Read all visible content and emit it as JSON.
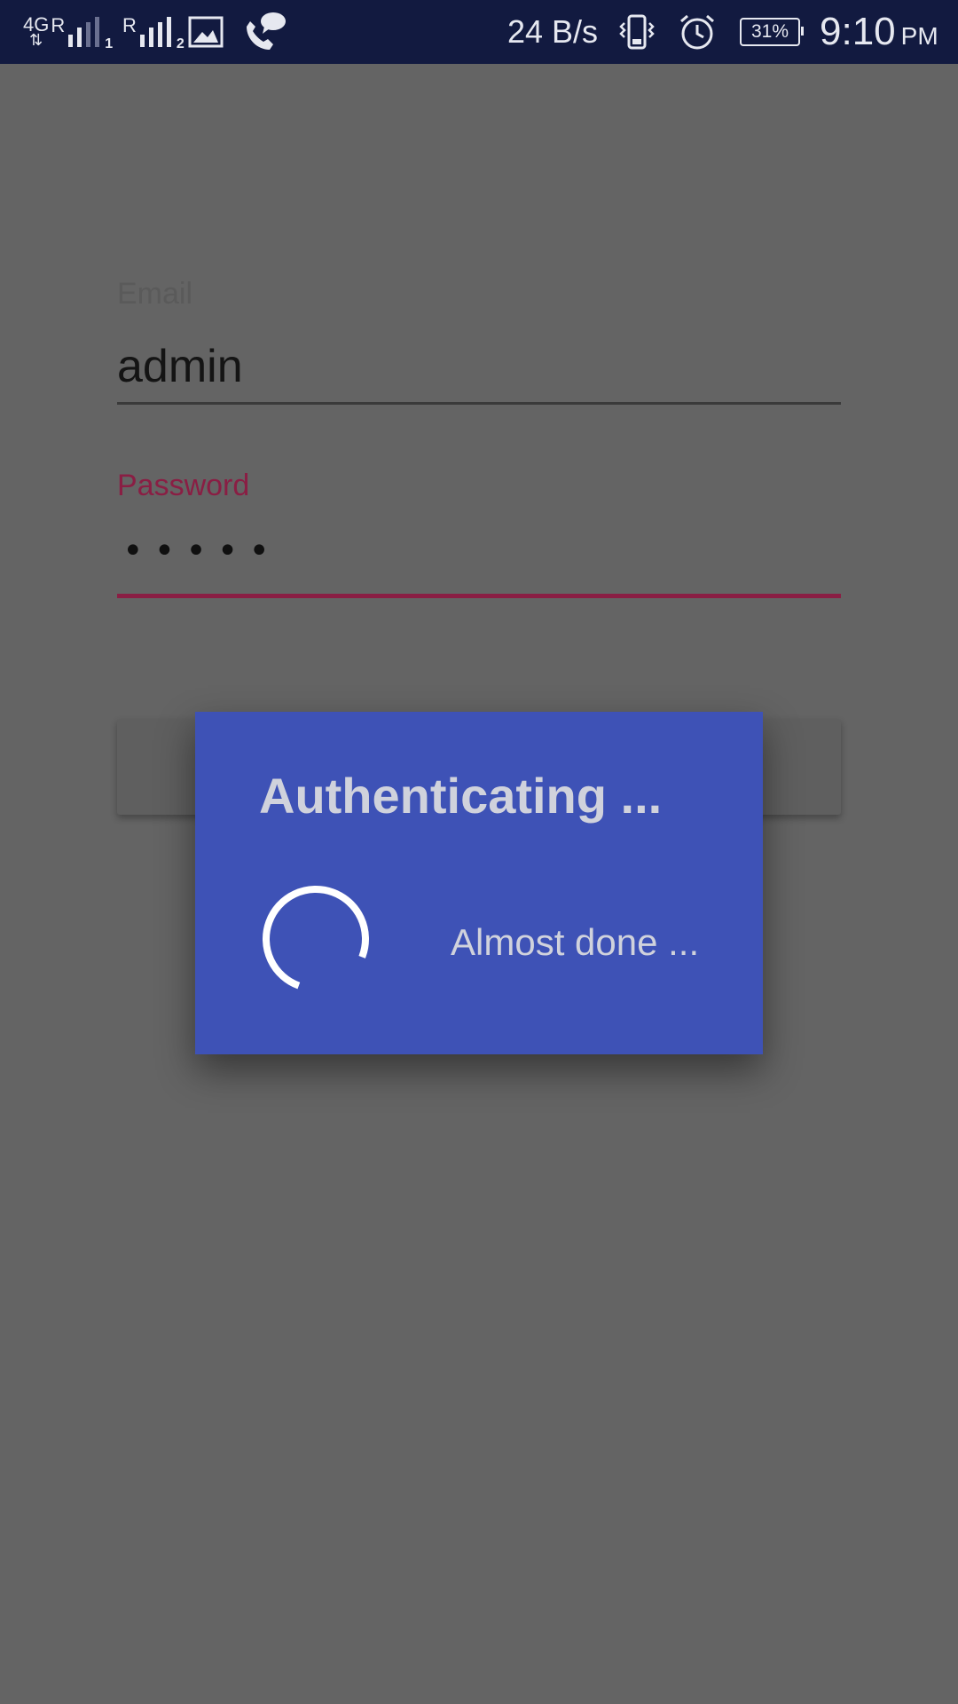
{
  "status_bar": {
    "network_type": "4G",
    "sim1_label": "R",
    "sim1_number": "1",
    "sim2_label": "R",
    "sim2_number": "2",
    "net_speed": "24 B/s",
    "battery": "31%",
    "time": "9:10",
    "ampm": "PM",
    "icons": [
      "signal-icon",
      "image-icon",
      "phone-chat-icon",
      "vibrate-icon",
      "alarm-icon",
      "battery-icon"
    ]
  },
  "login_form": {
    "email_label": "Email",
    "email_value": "admin",
    "password_label": "Password",
    "password_value": "•••••",
    "accent_color": "#8a1e44"
  },
  "dialog": {
    "title": "Authenticating ...",
    "message": "Almost done ...",
    "background_color": "#3e52b6"
  }
}
